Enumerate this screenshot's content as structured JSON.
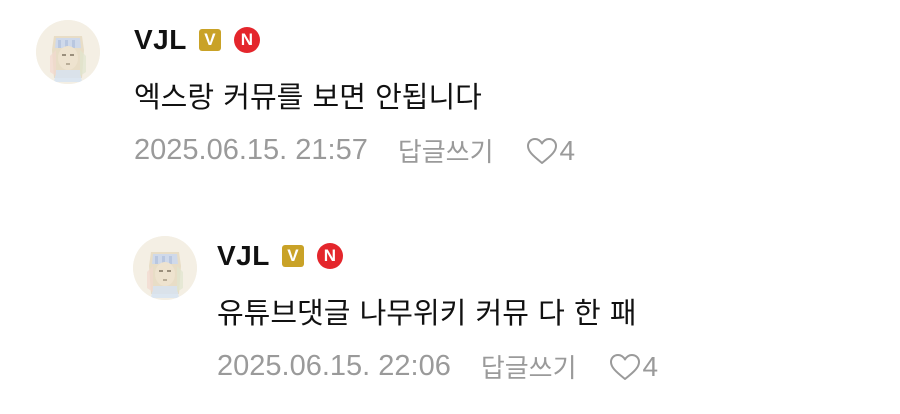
{
  "comments": [
    {
      "username": "VJL",
      "badge_v": "V",
      "badge_n": "N",
      "text": "엑스랑 커뮤를 보면 안됩니다",
      "timestamp": "2025.06.15. 21:57",
      "reply_label": "답글쓰기",
      "likes": "4",
      "avatar_icon": "sphinx-avatar-icon"
    },
    {
      "username": "VJL",
      "badge_v": "V",
      "badge_n": "N",
      "text": "유튜브댓글 나무위키 커뮤 다 한 패",
      "timestamp": "2025.06.15. 22:06",
      "reply_label": "답글쓰기",
      "likes": "4",
      "avatar_icon": "sphinx-avatar-icon"
    }
  ],
  "colors": {
    "badge_v": "#c9a227",
    "badge_n": "#e4262c",
    "meta_text": "#9a9a9a",
    "body_text": "#111111"
  }
}
